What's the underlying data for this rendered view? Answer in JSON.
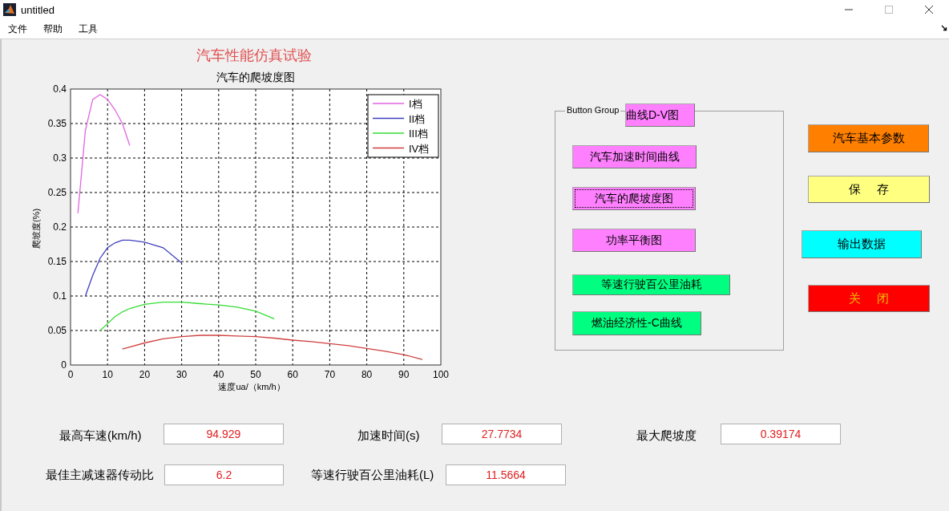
{
  "window": {
    "title": "untitled"
  },
  "menu": [
    "文件",
    "帮助",
    "工具"
  ],
  "heading": "汽车性能仿真试验",
  "chart": {
    "chart_data": {
      "type": "line",
      "title": "汽车的爬坡度图",
      "xlabel": "速度ua/（km/h）",
      "ylabel": "爬坡度(%)",
      "x": [
        2,
        4,
        6,
        8,
        10,
        12,
        14,
        16,
        20,
        25,
        30,
        35,
        40,
        45,
        50,
        55,
        60,
        65,
        70,
        75,
        80,
        85,
        90,
        95
      ],
      "series": [
        {
          "name": "I档",
          "color": "#e066e0",
          "values": [
            0.22,
            0.34,
            0.385,
            0.392,
            0.385,
            0.37,
            0.35,
            0.318,
            null,
            null,
            null,
            null,
            null,
            null,
            null,
            null,
            null,
            null,
            null,
            null,
            null,
            null,
            null,
            null
          ]
        },
        {
          "name": "II档",
          "color": "#4040c0",
          "values": [
            null,
            0.1,
            0.13,
            0.155,
            0.17,
            0.177,
            0.181,
            0.181,
            0.178,
            0.17,
            0.148,
            null,
            null,
            null,
            null,
            null,
            null,
            null,
            null,
            null,
            null,
            null,
            null,
            null
          ]
        },
        {
          "name": "III档",
          "color": "#33dd33",
          "values": [
            null,
            null,
            null,
            0.05,
            0.06,
            0.07,
            0.077,
            0.082,
            0.088,
            0.091,
            0.091,
            0.089,
            0.087,
            0.084,
            0.078,
            0.067,
            null,
            null,
            null,
            null,
            null,
            null,
            null,
            null
          ]
        },
        {
          "name": "IV档",
          "color": "#d04040",
          "values": [
            null,
            null,
            null,
            null,
            null,
            null,
            0.023,
            0.026,
            0.032,
            0.038,
            0.041,
            0.043,
            0.043,
            0.042,
            0.041,
            0.039,
            0.036,
            0.034,
            0.031,
            0.028,
            0.024,
            0.02,
            0.015,
            0.008
          ]
        }
      ],
      "xlim": [
        0,
        100
      ],
      "ylim": [
        0,
        0.4
      ],
      "xticks": [
        0,
        10,
        20,
        30,
        40,
        50,
        60,
        70,
        80,
        90,
        100
      ],
      "yticks": [
        0,
        0.05,
        0.1,
        0.15,
        0.2,
        0.25,
        0.3,
        0.35,
        0.4
      ],
      "grid": true,
      "legend": true
    }
  },
  "button_group": {
    "label": "Button Group",
    "buttons": [
      {
        "label": "曲线D-V图",
        "color": "#ff80ff",
        "focused": false
      },
      {
        "label": "汽车加速时间曲线",
        "color": "#ff80ff",
        "focused": false
      },
      {
        "label": "汽车的爬坡度图",
        "color": "#ff80ff",
        "focused": true
      },
      {
        "label": "功率平衡图",
        "color": "#ff80ff",
        "focused": false
      },
      {
        "label": "等速行驶百公里油耗",
        "color": "#00ff80",
        "focused": false
      },
      {
        "label": "燃油经济性-C曲线",
        "color": "#00ff80",
        "focused": false
      }
    ]
  },
  "side_buttons": [
    {
      "label": "汽车基本参数",
      "color": "#ff8000",
      "kind": "normal"
    },
    {
      "label": "保     存",
      "color": "#ffff80",
      "kind": "normal"
    },
    {
      "label": "输出数据",
      "color": "#00ffff",
      "kind": "normal"
    },
    {
      "label": "关     闭",
      "color": "#ff0000",
      "kind": "danger"
    }
  ],
  "outputs": [
    {
      "label": "最高车速(km/h)",
      "value": "94.929"
    },
    {
      "label": "加速时间(s)",
      "value": "27.7734"
    },
    {
      "label": "最大爬坡度",
      "value": "0.39174"
    },
    {
      "label": "最佳主减速器传动比",
      "value": "6.2"
    },
    {
      "label": "等速行驶百公里油耗(L)",
      "value": "11.5664"
    }
  ]
}
